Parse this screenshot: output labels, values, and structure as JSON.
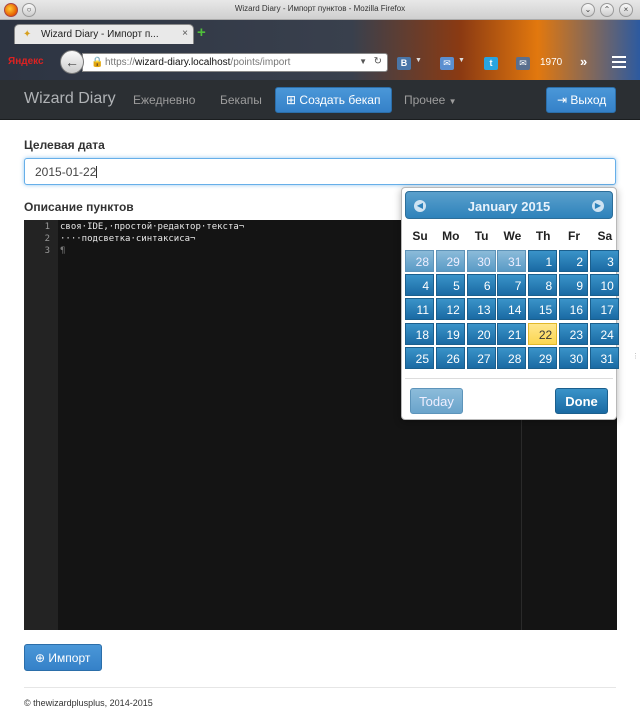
{
  "window": {
    "title": "Wizard Diary - Импорт пунктов - Mozilla Firefox"
  },
  "browser": {
    "tab_title": "Wizard Diary - Импорт п...",
    "tab_close": "×",
    "new_tab": "+",
    "url_scheme": "https://",
    "url_host": "wizard-diary.localhost",
    "url_path": "/points/import",
    "yandex_label": "Яндекс",
    "toolbar_count": "1970",
    "more_glyph": "»",
    "vk_label": "В"
  },
  "navbar": {
    "brand": "Wizard Diary",
    "daily": "Ежедневно",
    "backups": "Бекапы",
    "create_backup": "Создать бекап",
    "more": "Прочее",
    "logout": "Выход"
  },
  "form": {
    "target_date_label": "Целевая дата",
    "target_date_value": "2015-01-22",
    "description_label": "Описание пунктов",
    "import_button": "Импорт"
  },
  "editor": {
    "line_numbers": [
      "1",
      "2",
      "3"
    ],
    "lines": [
      "своя·IDE,·простой·редактор·текста¬",
      "····подсветка·синтаксиса¬",
      "¶"
    ]
  },
  "datepicker": {
    "month_title": "January 2015",
    "prev_icon": "◀",
    "next_icon": "▶",
    "weekdays": [
      "Su",
      "Mo",
      "Tu",
      "We",
      "Th",
      "Fr",
      "Sa"
    ],
    "weeks": [
      [
        "28",
        "29",
        "30",
        "31",
        "1",
        "2",
        "3"
      ],
      [
        "4",
        "5",
        "6",
        "7",
        "8",
        "9",
        "10"
      ],
      [
        "11",
        "12",
        "13",
        "14",
        "15",
        "16",
        "17"
      ],
      [
        "18",
        "19",
        "20",
        "21",
        "22",
        "23",
        "24"
      ],
      [
        "25",
        "26",
        "27",
        "28",
        "29",
        "30",
        "31"
      ]
    ],
    "other_month_days": [
      "28",
      "29",
      "30",
      "31"
    ],
    "selected_day": "22",
    "today_button": "Today",
    "done_button": "Done"
  },
  "footer": {
    "text": "© thewizardplusplus, 2014-2015"
  },
  "colors": {
    "primary": "#3581c8",
    "navbar_bg": "#2b2f33",
    "highlight": "#fbd650",
    "editor_bg": "#141414"
  }
}
